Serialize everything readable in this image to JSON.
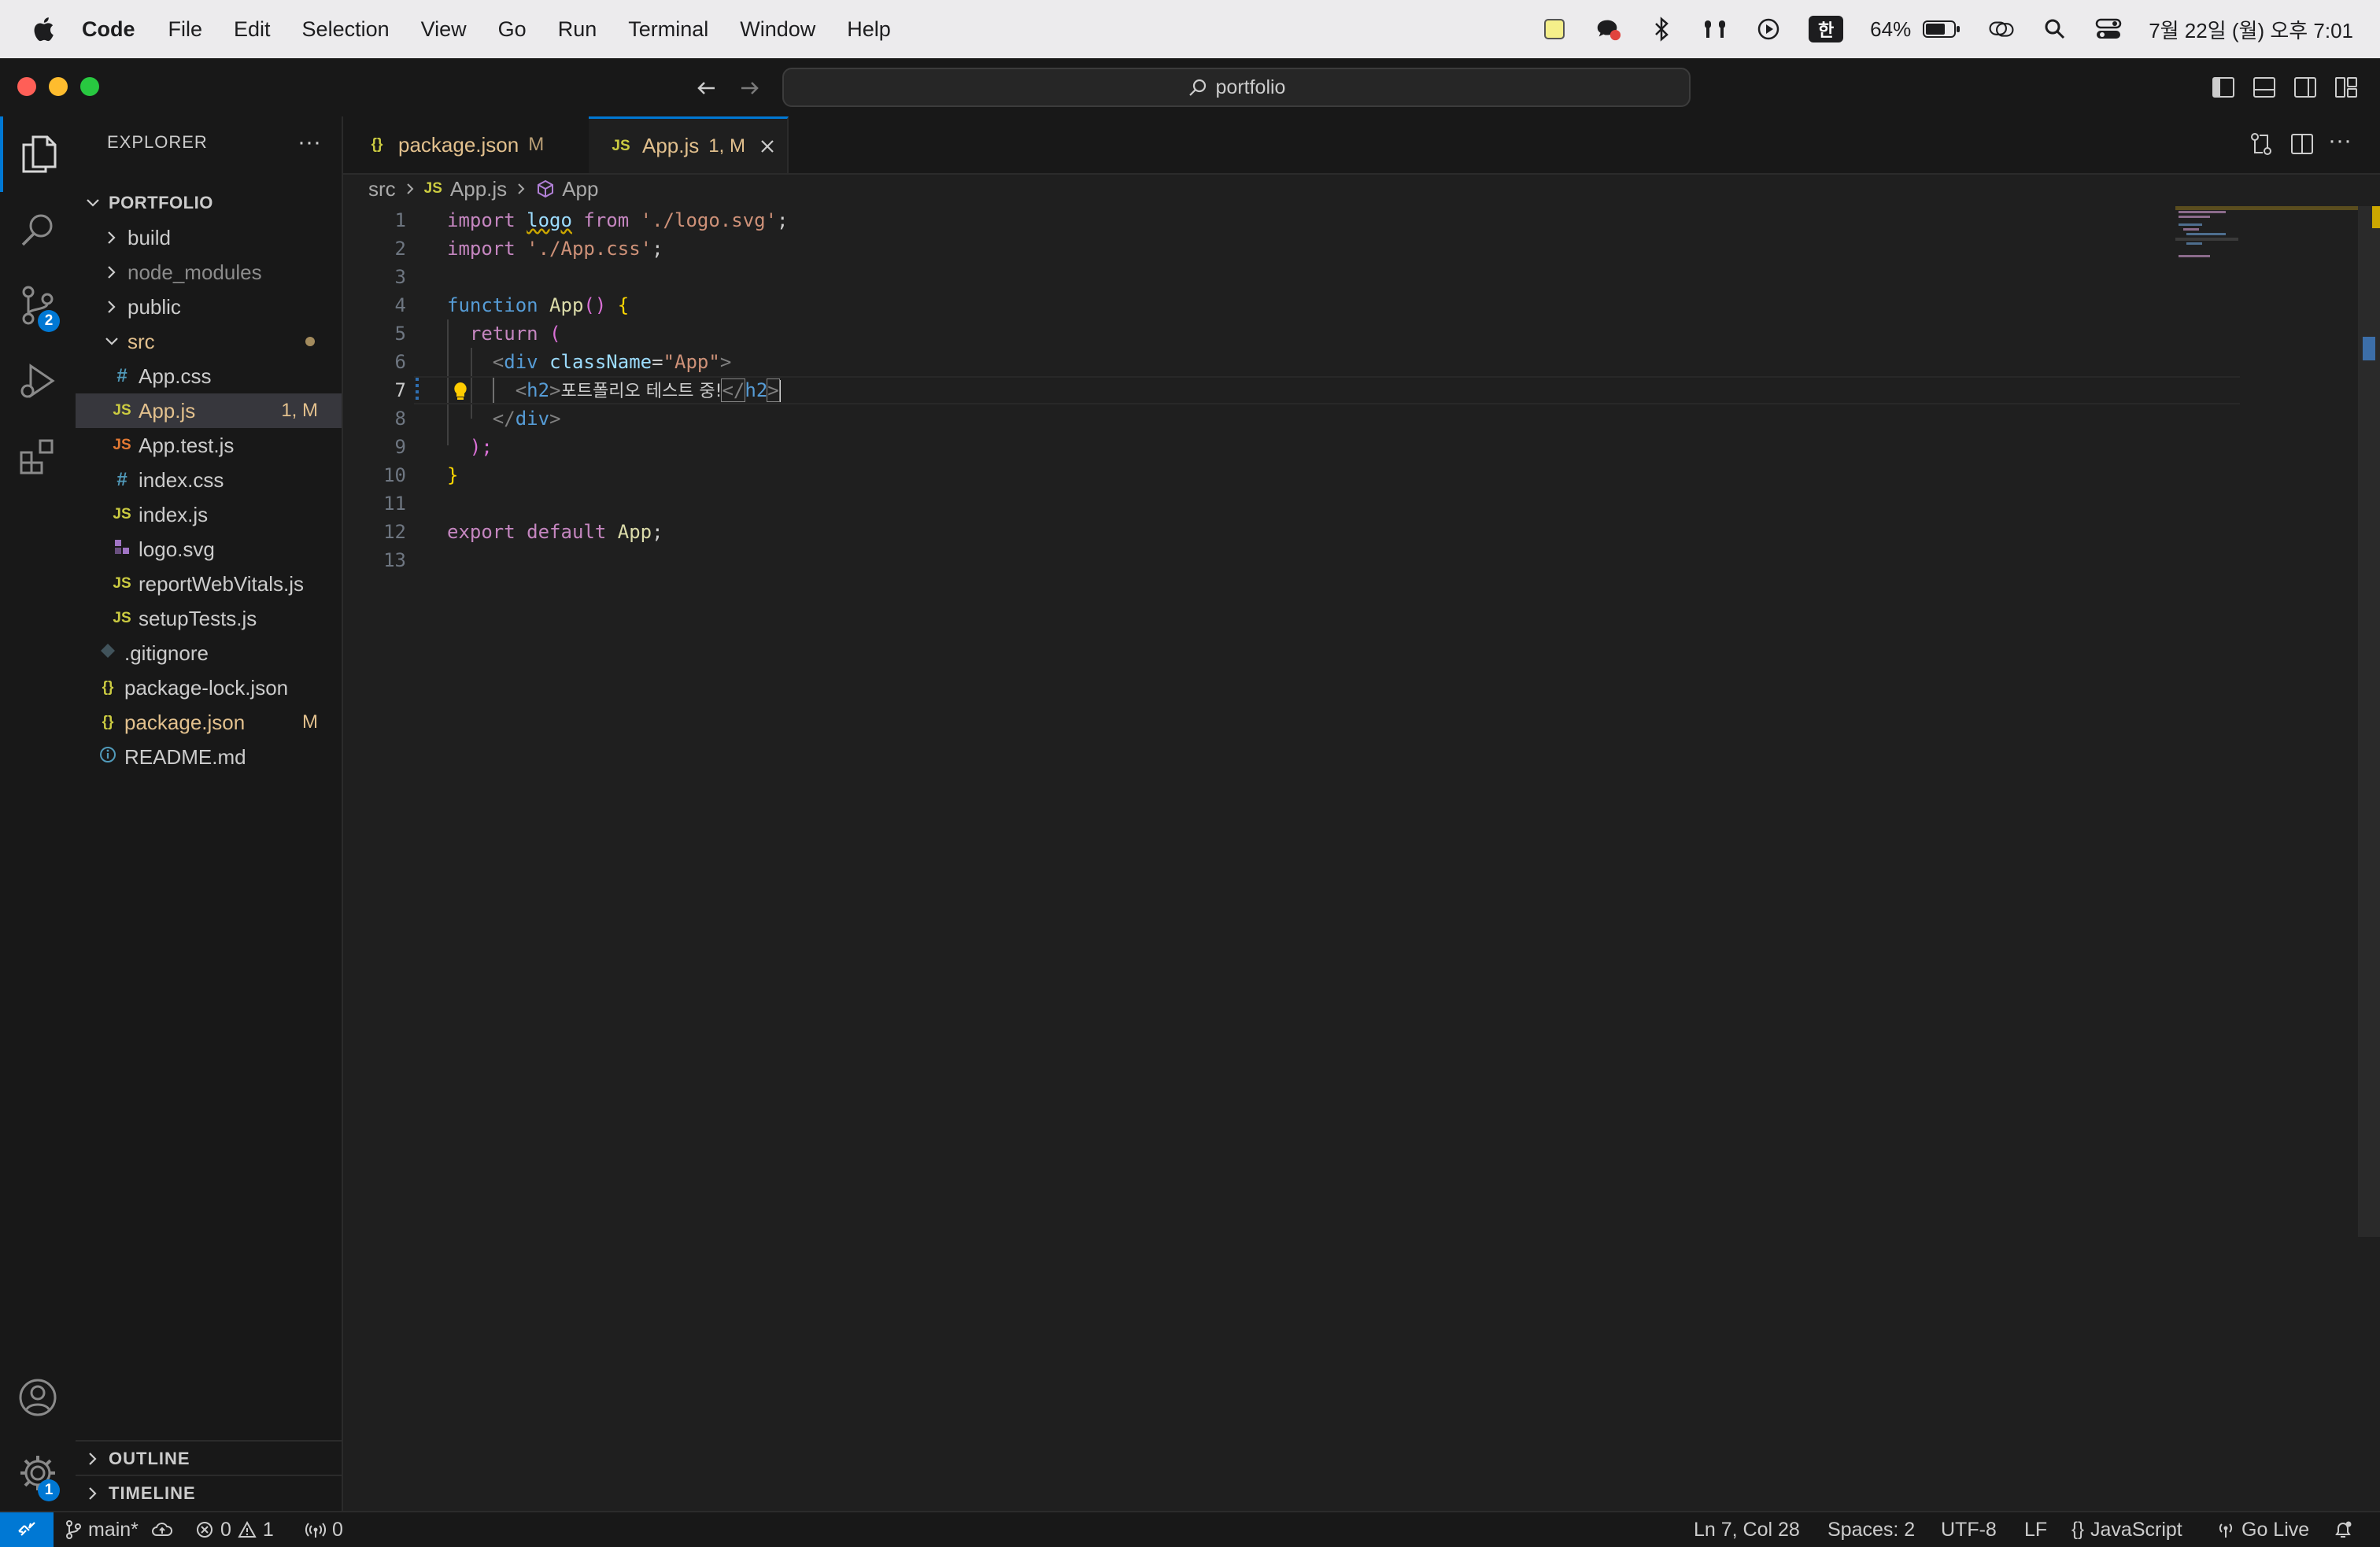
{
  "menubar": {
    "app_name": "Code",
    "items": [
      "File",
      "Edit",
      "Selection",
      "View",
      "Go",
      "Run",
      "Terminal",
      "Window",
      "Help"
    ],
    "battery": "64%",
    "input_method": "한",
    "clock": "7월 22일 (월) 오후 7:01"
  },
  "window": {
    "search_text": "portfolio"
  },
  "activity": {
    "scm_badge": "2",
    "settings_badge": "1"
  },
  "sidebar": {
    "title": "EXPLORER",
    "root": "PORTFOLIO",
    "items": [
      {
        "label": "build",
        "type": "folder"
      },
      {
        "label": "node_modules",
        "type": "folder"
      },
      {
        "label": "public",
        "type": "folder"
      },
      {
        "label": "src",
        "type": "folder-open"
      },
      {
        "label": "App.css",
        "type": "css"
      },
      {
        "label": "App.js",
        "type": "js",
        "status": "1, M"
      },
      {
        "label": "App.test.js",
        "type": "js"
      },
      {
        "label": "index.css",
        "type": "css"
      },
      {
        "label": "index.js",
        "type": "js"
      },
      {
        "label": "logo.svg",
        "type": "svg"
      },
      {
        "label": "reportWebVitals.js",
        "type": "js"
      },
      {
        "label": "setupTests.js",
        "type": "js"
      },
      {
        "label": ".gitignore",
        "type": "git"
      },
      {
        "label": "package-lock.json",
        "type": "json"
      },
      {
        "label": "package.json",
        "type": "json",
        "status": "M"
      },
      {
        "label": "README.md",
        "type": "info"
      }
    ],
    "outline": "OUTLINE",
    "timeline": "TIMELINE"
  },
  "tabs": [
    {
      "icon": "{}",
      "label": "package.json",
      "status": "M"
    },
    {
      "icon": "JS",
      "label": "App.js",
      "status": "1, M"
    }
  ],
  "breadcrumb": {
    "folder": "src",
    "file_icon": "JS",
    "file": "App.js",
    "symbol": "App"
  },
  "editor": {
    "line_numbers": [
      "1",
      "2",
      "3",
      "4",
      "5",
      "6",
      "7",
      "8",
      "9",
      "10",
      "11",
      "12",
      "13"
    ],
    "code": {
      "l1_import": "import",
      "l1_logo": "logo",
      "l1_from": "from",
      "l1_path": "'./logo.svg'",
      "l1_semi": ";",
      "l2_import": "import",
      "l2_path": "'./App.css'",
      "l2_semi": ";",
      "l4_function": "function",
      "l4_name": "App",
      "l4_paren": "()",
      "l4_brace": "{",
      "l5_return": "return",
      "l5_paren": "(",
      "l6_open": "<",
      "l6_tag": "div",
      "l6_attr": "className",
      "l6_eq": "=",
      "l6_val": "\"App\"",
      "l6_close": ">",
      "l7_open": "<",
      "l7_tag": "h2",
      "l7_gt": ">",
      "l7_text": "포트폴리오 테스트 중!",
      "l7_end_open": "</",
      "l7_end_tag": "h2",
      "l7_end_gt": ">",
      "l8_open": "</",
      "l8_tag": "div",
      "l8_gt": ">",
      "l9": ");",
      "l10": "}",
      "l12_export": "export",
      "l12_default": "default",
      "l12_name": "App",
      "l12_semi": ";"
    }
  },
  "statusbar": {
    "branch": "main*",
    "errors": "0",
    "warnings": "1",
    "ports": "0",
    "position": "Ln 7, Col 28",
    "spaces": "Spaces: 2",
    "encoding": "UTF-8",
    "eol": "LF",
    "language": "JavaScript",
    "go_live": "Go Live"
  },
  "colors": {
    "accent": "#0078d4",
    "modified": "#e2c08d",
    "js_icon": "#cbcb41",
    "css_icon": "#519aba",
    "svg_icon": "#a074c4"
  }
}
